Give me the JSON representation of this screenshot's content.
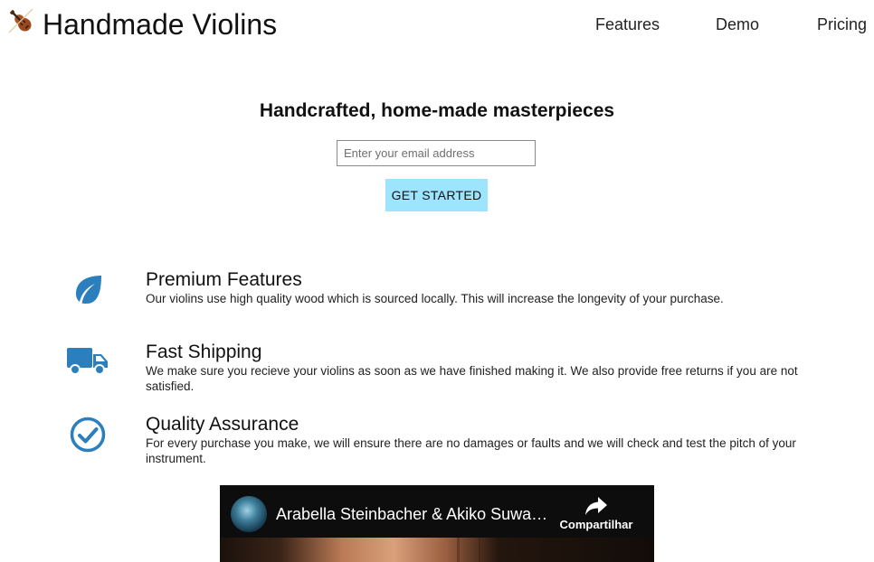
{
  "header": {
    "logo_icon": "violin-icon",
    "brand": "Handmade Violins",
    "nav": [
      {
        "label": "Features"
      },
      {
        "label": "Demo"
      },
      {
        "label": "Pricing"
      }
    ]
  },
  "hero": {
    "title": "Handcrafted, home-made masterpieces",
    "email_placeholder": "Enter your email address",
    "email_value": "",
    "cta_label": "GET STARTED"
  },
  "features": [
    {
      "icon": "leaf-icon",
      "title": "Premium Features",
      "text": "Our violins use high quality wood which is sourced locally. This will increase the longevity of your purchase."
    },
    {
      "icon": "truck-icon",
      "title": "Fast Shipping",
      "text": "We make sure you recieve your violins as soon as we have finished making it. We also provide free returns if you are not satisfied."
    },
    {
      "icon": "check-circle-icon",
      "title": "Quality Assurance",
      "text": "For every purchase you make, we will ensure there are no damages or faults and we will check and test the pitch of your instrument."
    }
  ],
  "video": {
    "title": "Arabella Steinbacher & Akiko Suwanai…",
    "share_label": "Compartilhar",
    "share_icon": "share-arrow-icon"
  },
  "colors": {
    "accent_icon": "#2b7fbd",
    "cta_background": "#9de5ff",
    "video_background": "#0d0d0d"
  }
}
